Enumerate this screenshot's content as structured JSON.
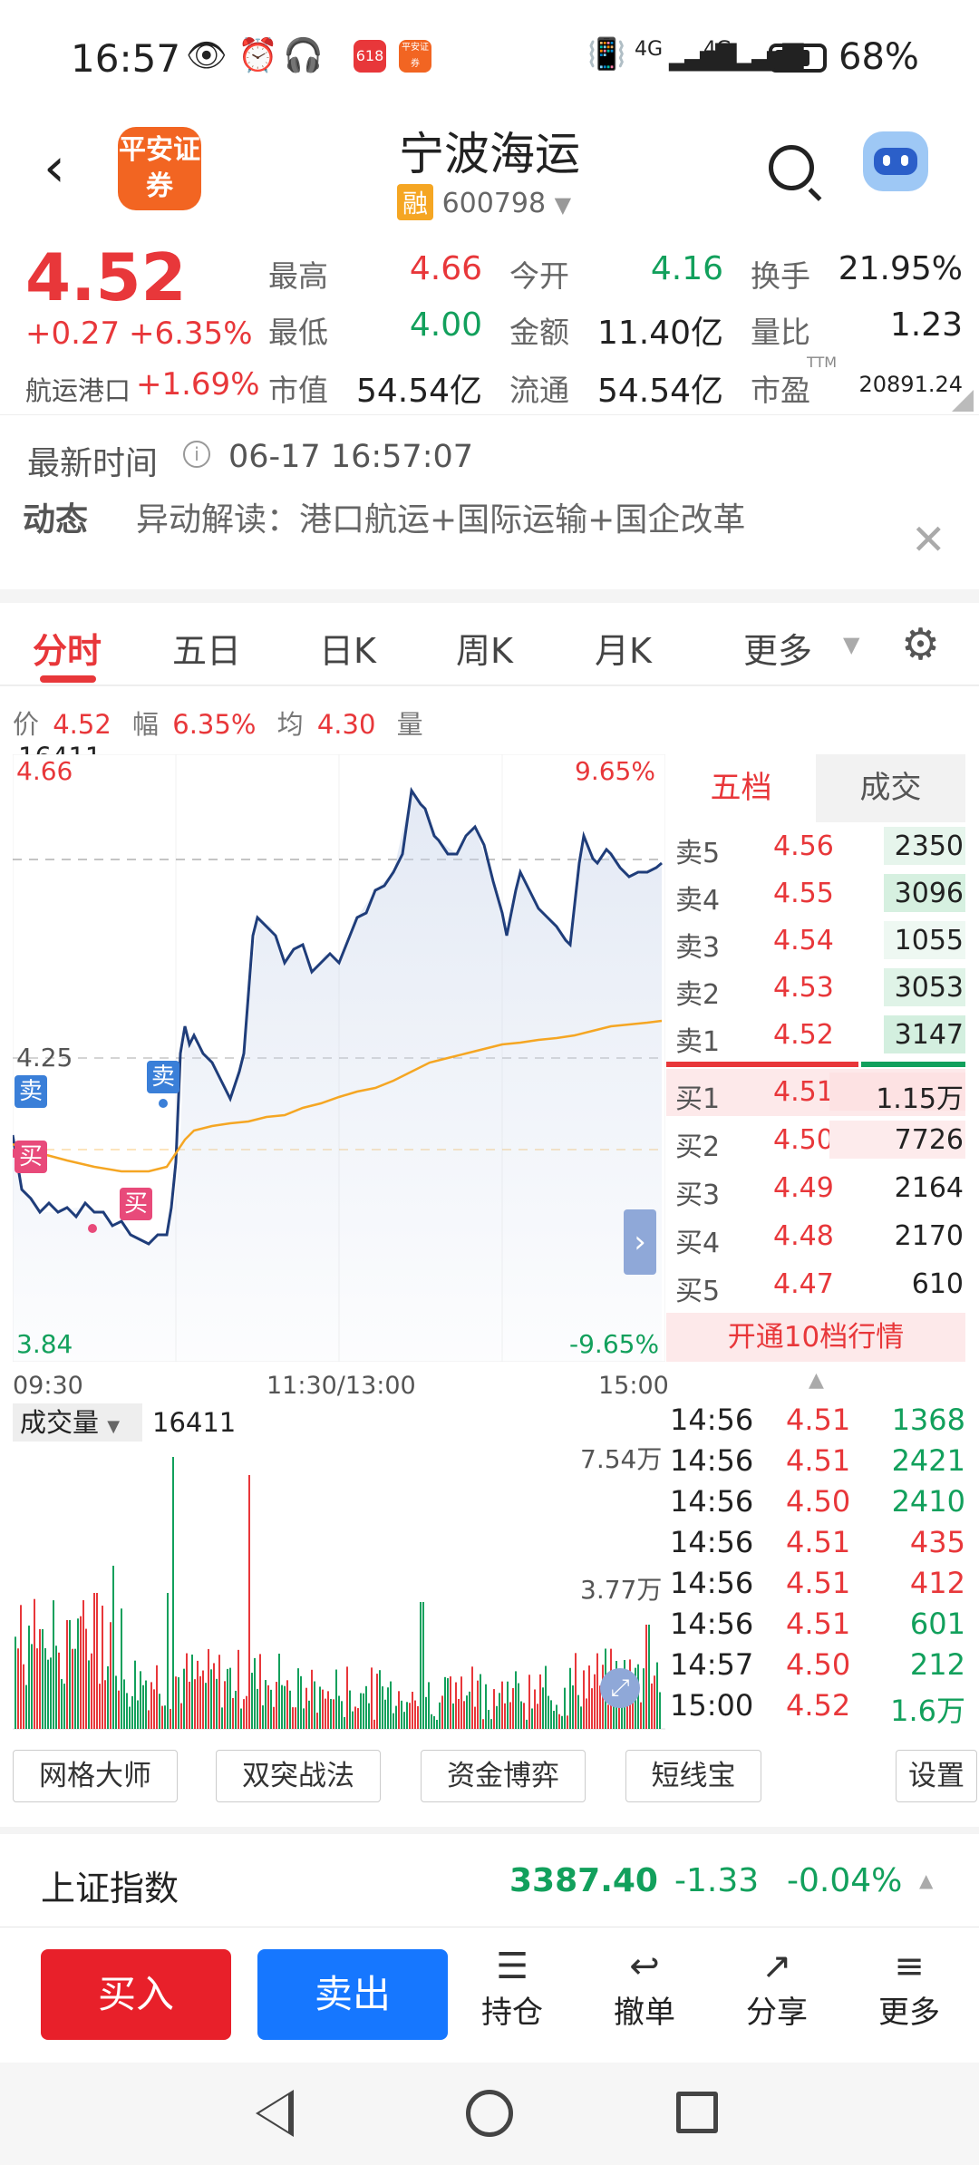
{
  "status": {
    "time": "16:57",
    "net1": "4G",
    "net2": "4G",
    "battery": "68%",
    "notif1": "618",
    "notif2": "平安证券"
  },
  "header": {
    "logo": "平安证券",
    "title": "宁波海运",
    "badge": "融",
    "code": "600798"
  },
  "quote": {
    "price": "4.52",
    "change": "+0.27",
    "change_pct": "+6.35%",
    "sector": "航运港口",
    "sector_pct": "+1.69%",
    "high_label": "最高",
    "high": "4.66",
    "open_label": "今开",
    "open": "4.16",
    "turnover_label": "换手",
    "turnover": "21.95%",
    "low_label": "最低",
    "low": "4.00",
    "amount_label": "金额",
    "amount": "11.40亿",
    "volratio_label": "量比",
    "volratio": "1.23",
    "mcap_label": "市值",
    "mcap": "54.54亿",
    "float_label": "流通",
    "float": "54.54亿",
    "pe_label": "市盈",
    "pe_sup": "TTM",
    "pe": "20891.24"
  },
  "update": {
    "label": "最新时间",
    "time": "06-17 16:57:07"
  },
  "news": {
    "tag": "动态",
    "text": "异动解读：港口航运+国际运输+国企改革"
  },
  "tabs": [
    "分时",
    "五日",
    "日K",
    "周K",
    "月K",
    "更多"
  ],
  "chart_info": {
    "price_label": "价",
    "price": "4.52",
    "range_label": "幅",
    "range": "6.35%",
    "avg_label": "均",
    "avg": "4.30",
    "vol_label": "量",
    "vol": "16411"
  },
  "chart_axis": {
    "top": "4.66",
    "mid": "4.25",
    "bottom": "3.84",
    "top_pct": "9.65%",
    "bottom_pct": "-9.65%",
    "t_start": "09:30",
    "t_mid": "11:30/13:00",
    "t_end": "15:00"
  },
  "chart_marks": {
    "sell": "卖",
    "buy": "买"
  },
  "volume": {
    "label": "成交量",
    "value": "16411",
    "max": "7.54万",
    "half": "3.77万"
  },
  "orderbook": {
    "tab_active": "五档",
    "tab_other": "成交",
    "asks": [
      {
        "label": "卖5",
        "price": "4.56",
        "vol": "2350"
      },
      {
        "label": "卖4",
        "price": "4.55",
        "vol": "3096"
      },
      {
        "label": "卖3",
        "price": "4.54",
        "vol": "1055"
      },
      {
        "label": "卖2",
        "price": "4.53",
        "vol": "3053"
      },
      {
        "label": "卖1",
        "price": "4.52",
        "vol": "3147"
      }
    ],
    "bids": [
      {
        "label": "买1",
        "price": "4.51",
        "vol": "1.15万"
      },
      {
        "label": "买2",
        "price": "4.50",
        "vol": "7726"
      },
      {
        "label": "买3",
        "price": "4.49",
        "vol": "2164"
      },
      {
        "label": "买4",
        "price": "4.48",
        "vol": "2170"
      },
      {
        "label": "买5",
        "price": "4.47",
        "vol": "610"
      }
    ],
    "open10": "开通10档行情"
  },
  "ticks": [
    {
      "time": "14:56",
      "price": "4.51",
      "vol": "1368",
      "dir": "green"
    },
    {
      "time": "14:56",
      "price": "4.51",
      "vol": "2421",
      "dir": "green"
    },
    {
      "time": "14:56",
      "price": "4.50",
      "vol": "2410",
      "dir": "green"
    },
    {
      "time": "14:56",
      "price": "4.51",
      "vol": "435",
      "dir": "red"
    },
    {
      "time": "14:56",
      "price": "4.51",
      "vol": "412",
      "dir": "red"
    },
    {
      "time": "14:56",
      "price": "4.51",
      "vol": "601",
      "dir": "green"
    },
    {
      "time": "14:57",
      "price": "4.50",
      "vol": "212",
      "dir": "green"
    },
    {
      "time": "15:00",
      "price": "4.52",
      "vol": "1.6万",
      "dir": "green"
    }
  ],
  "tools": [
    "网格大师",
    "双突战法",
    "资金博弈",
    "短线宝",
    "设置"
  ],
  "index": {
    "name": "上证指数",
    "value": "3387.40",
    "change": "-1.33",
    "pct": "-0.04%"
  },
  "actions": {
    "buy": "买入",
    "sell": "卖出",
    "hold": "持仓",
    "cancel": "撤单",
    "share": "分享",
    "more": "更多"
  },
  "colors": {
    "red": "#e8373a",
    "green": "#12a05c",
    "blue": "#1677ff",
    "line": "#1f3d7a",
    "avg": "#f5a623"
  }
}
